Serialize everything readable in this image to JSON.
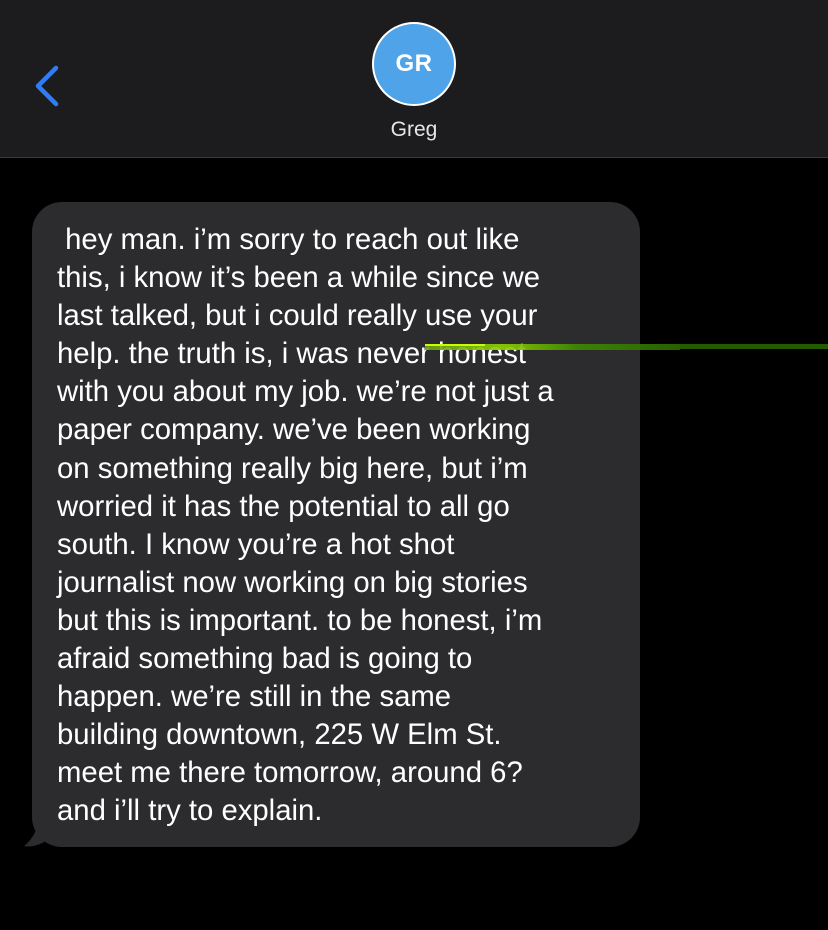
{
  "header": {
    "back_icon": "chevron-left-icon",
    "avatar_initials": "GR",
    "contact_name": "Greg"
  },
  "colors": {
    "header_bg": "#1c1c1e",
    "accent": "#2f7cf6",
    "avatar_bg": "#4fa3e8",
    "bubble_bg": "#2c2c2e",
    "screen_bg": "#000000"
  },
  "messages": [
    {
      "direction": "incoming",
      "text": " hey man. i’m sorry to reach out like\nthis, i know it’s been a while since we\nlast talked, but i could really use your\nhelp. the truth is, i was never honest\nwith you about my job. we’re not just a\npaper company. we’ve been working\non something really big here, but i’m\nworried it has the potential to all go\nsouth. I know you’re a hot shot\njournalist now working on big stories\nbut this is important. to be honest, i’m\nafraid something bad is going to\nhappen. we’re still in the same\nbuilding downtown, 225 W Elm St.\nmeet me there tomorrow, around 6?\nand i’ll try to explain."
    }
  ]
}
